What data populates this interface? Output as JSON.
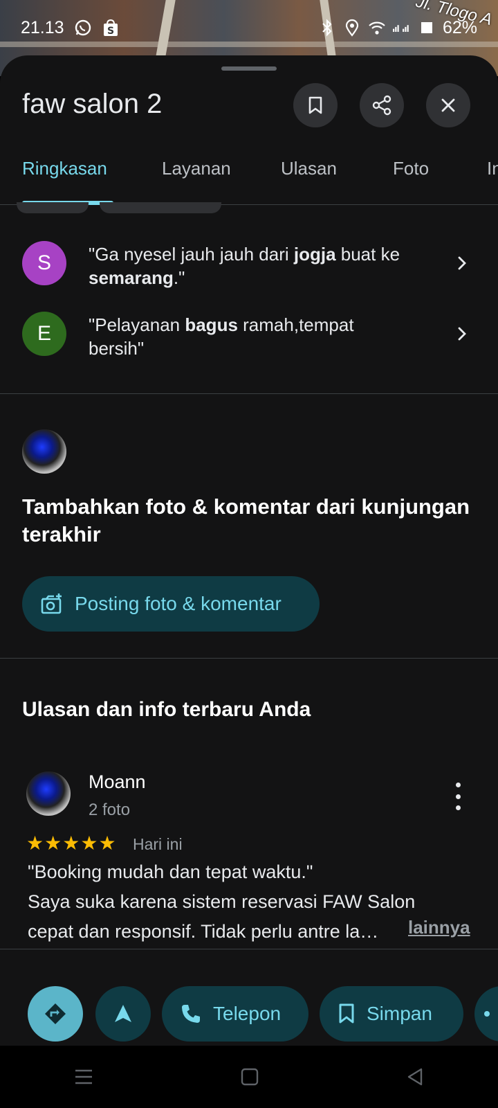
{
  "map": {
    "road_label": "Jl. Tlogo A"
  },
  "status_bar": {
    "time": "21.13",
    "battery": "62%"
  },
  "place": {
    "title": "faw salon 2"
  },
  "tabs": [
    {
      "label": "Ringkasan"
    },
    {
      "label": "Layanan"
    },
    {
      "label": "Ulasan"
    },
    {
      "label": "Foto"
    },
    {
      "label": "In"
    }
  ],
  "snippets": [
    {
      "initial": "S",
      "color": "#a742c4",
      "parts": [
        "\"Ga nyesel jauh jauh dari ",
        "jogja",
        " buat ke ",
        "semarang",
        ".\""
      ]
    },
    {
      "initial": "E",
      "color": "#2e6b1e",
      "parts": [
        "\"Pelayanan ",
        "bagus",
        " ramah,tempat bersih\""
      ]
    }
  ],
  "contribute": {
    "prompt": "Tambahkan foto & komentar dari kunjungan terakhir",
    "button_label": "Posting foto & komentar"
  },
  "my_reviews": {
    "section_title": "Ulasan dan info terbaru Anda",
    "review": {
      "author": "Moann",
      "photos": "2 foto",
      "rating": 5,
      "date": "Hari ini",
      "text_line1": "\"Booking mudah dan tepat waktu.\"",
      "text_line2": "Saya suka karena sistem reservasi FAW Salon",
      "text_line3": "cepat dan responsif. Tidak perlu antre la…",
      "more_label": "lainnya"
    }
  },
  "actions": {
    "call_label": "Telepon",
    "save_label": "Simpan"
  },
  "colors": {
    "accent": "#78d9ec",
    "pill_bg": "#0f3b44",
    "directions_bg": "#5bb5c9",
    "star": "#fbbc04"
  }
}
